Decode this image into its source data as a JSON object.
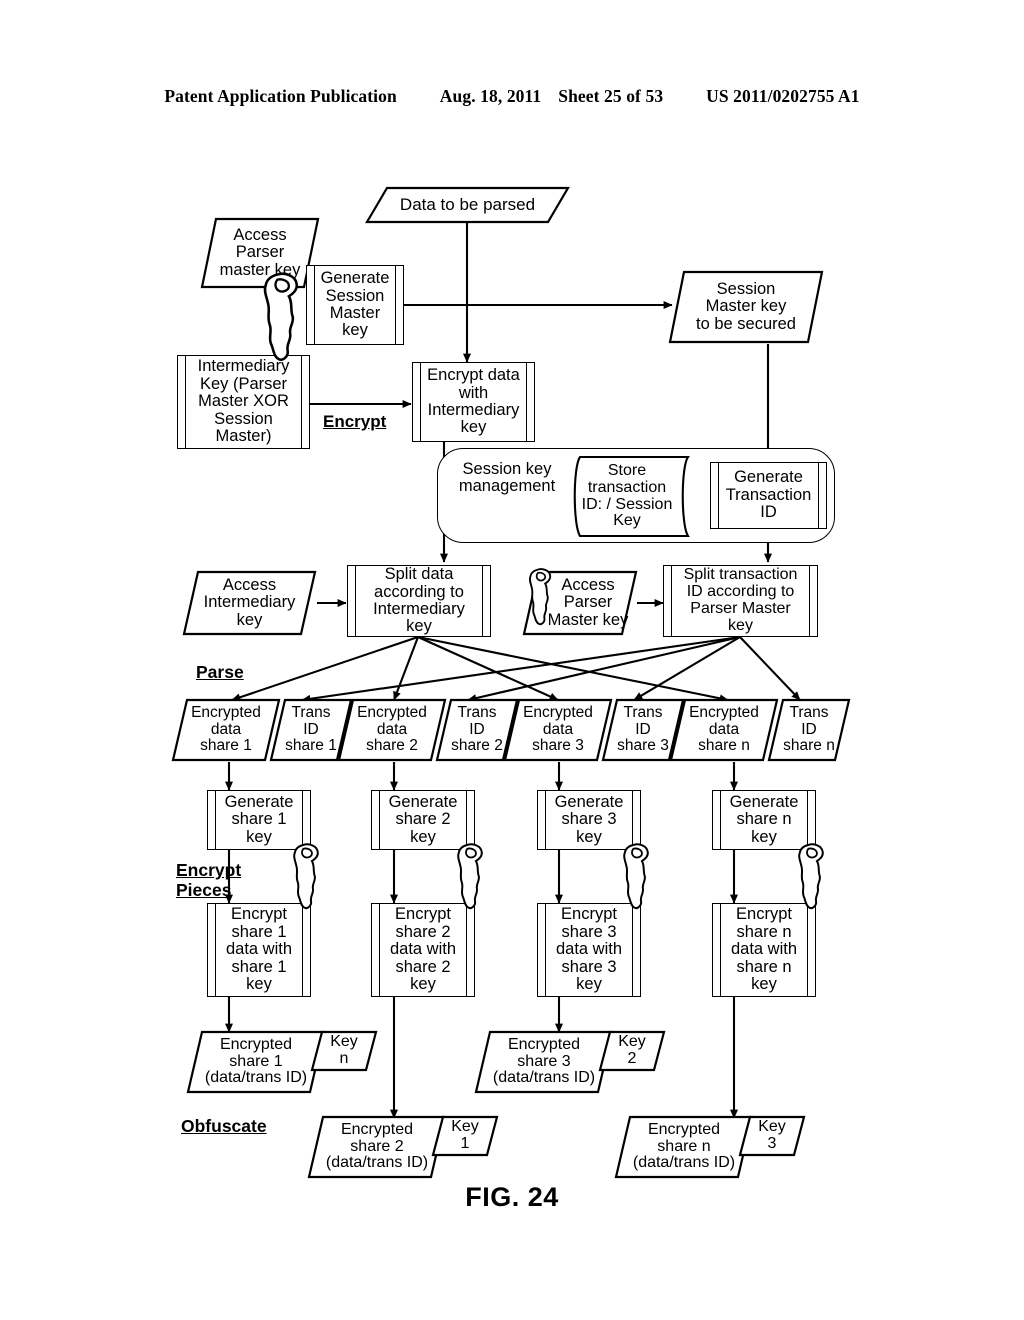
{
  "header": {
    "publication": "Patent Application Publication",
    "date": "Aug. 18, 2011",
    "sheet": "Sheet 25 of 53",
    "number": "US 2011/0202755 A1"
  },
  "figure": {
    "caption": "FIG. 24"
  },
  "stage_labels": {
    "encrypt": "Encrypt",
    "parse": "Parse",
    "encrypt_pieces": "Encrypt\nPieces",
    "obfuscate": "Obfuscate"
  },
  "nodes": {
    "data_to_be_parsed": "Data to be parsed",
    "access_parser_master_key_top": "Access\nParser\nmaster key",
    "generate_session_master_key": "Generate\nSession\nMaster\nkey",
    "session_master_key_to_be_secured": "Session\nMaster key\nto be secured",
    "intermediary_key": "Intermediary\nKey (Parser\nMaster XOR\nSession\nMaster)",
    "encrypt_data_with_intermediary_key": "Encrypt data\nwith\nIntermediary\nkey",
    "session_key_management": "Session key\nmanagement",
    "store_transaction": "Store\ntransaction\nID: / Session\nKey",
    "generate_transaction_id": "Generate\nTransaction\nID",
    "access_intermediary_key": "Access\nIntermediary\nkey",
    "split_data_according_to_intermediary_key": "Split data\naccording to\nIntermediary\nkey",
    "access_parser_master_key_mid": "Access\nParser\nMaster key",
    "split_transaction_id": "Split transaction\nID according to\nParser Master\nkey"
  },
  "shares": [
    {
      "data": "Encrypted\ndata\nshare 1",
      "trans": "Trans\nID\nshare 1"
    },
    {
      "data": "Encrypted\ndata\nshare 2",
      "trans": "Trans\nID\nshare 2"
    },
    {
      "data": "Encrypted\ndata\nshare 3",
      "trans": "Trans\nID\nshare 3"
    },
    {
      "data": "Encrypted\ndata\nshare n",
      "trans": "Trans\nID\nshare n"
    }
  ],
  "generate_share_keys": [
    "Generate\nshare 1\nkey",
    "Generate\nshare 2\nkey",
    "Generate\nshare 3\nkey",
    "Generate\nshare n\nkey"
  ],
  "encrypt_share_boxes": [
    "Encrypt\nshare 1\ndata with\nshare 1\nkey",
    "Encrypt\nshare 2\ndata with\nshare 2\nkey",
    "Encrypt\nshare 3\ndata with\nshare 3\nkey",
    "Encrypt\nshare n\ndata with\nshare n\nkey"
  ],
  "outputs": [
    {
      "share": "Encrypted\nshare 1\n(data/trans ID)",
      "key": "Key\nn"
    },
    {
      "share": "Encrypted\nshare 3\n(data/trans ID)",
      "key": "Key\n2"
    },
    {
      "share": "Encrypted\nshare 2\n(data/trans ID)",
      "key": "Key\n1"
    },
    {
      "share": "Encrypted\nshare n\n(data/trans ID)",
      "key": "Key\n3"
    }
  ],
  "icons": {
    "key": "key-icon",
    "arrow": "arrow-head"
  },
  "colors": {
    "ink": "#000000",
    "paper": "#ffffff"
  }
}
